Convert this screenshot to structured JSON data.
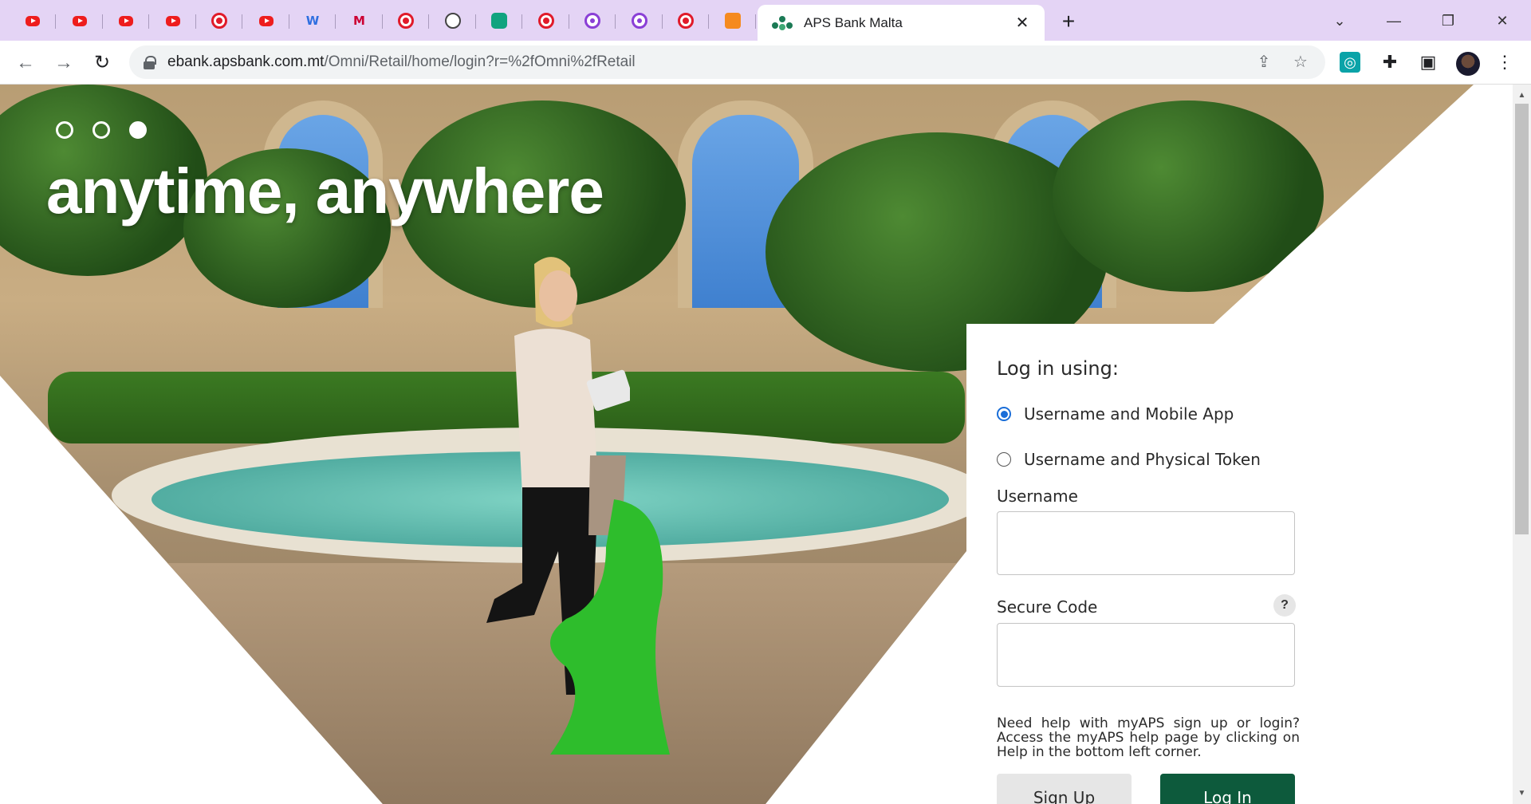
{
  "browser": {
    "mini_tabs": [
      {
        "icon": "youtube-icon",
        "type": "yt"
      },
      {
        "icon": "youtube-icon",
        "type": "yt"
      },
      {
        "icon": "youtube-icon",
        "type": "yt"
      },
      {
        "icon": "youtube-icon",
        "type": "yt"
      },
      {
        "icon": "red-circle-icon",
        "type": "ring"
      },
      {
        "icon": "youtube-icon",
        "type": "yt"
      },
      {
        "icon": "w-logo-icon",
        "type": "w",
        "glyph": "W"
      },
      {
        "icon": "gmail-icon",
        "type": "m",
        "glyph": "M"
      },
      {
        "icon": "red-circle-icon",
        "type": "ring"
      },
      {
        "icon": "openai-icon",
        "type": "gpt"
      },
      {
        "icon": "chatgpt-icon",
        "type": "gptg"
      },
      {
        "icon": "red-circle-icon",
        "type": "ring"
      },
      {
        "icon": "purple-circle-icon",
        "type": "purple"
      },
      {
        "icon": "purple-circle-icon",
        "type": "purple"
      },
      {
        "icon": "red-circle-icon",
        "type": "ring"
      },
      {
        "icon": "fox-icon",
        "type": "fox"
      }
    ],
    "active_tab": {
      "title": "APS Bank Malta",
      "close": "✕"
    },
    "new_tab": "+",
    "window": {
      "dropdown": "⌄",
      "minimize": "—",
      "restore": "❐",
      "close": "✕"
    },
    "nav": {
      "back": "←",
      "forward": "→",
      "reload": "↻"
    },
    "url": {
      "host": "ebank.apsbank.com.mt",
      "path": "/Omni/Retail/home/login?r=%2fOmni%2fRetail"
    },
    "omni_icons": {
      "share": "⇪",
      "bookmark": "☆"
    },
    "extensions": {
      "ext1": "◎",
      "puzzle": "✚",
      "sidepanel": "▣",
      "menu": "⋮"
    }
  },
  "hero": {
    "caption": "anytime, anywhere",
    "dots": [
      {
        "active": false
      },
      {
        "active": false
      },
      {
        "active": true
      }
    ]
  },
  "login": {
    "heading": "Log in using:",
    "options": [
      {
        "label": "Username and Mobile App",
        "checked": true
      },
      {
        "label": "Username and Physical Token",
        "checked": false
      }
    ],
    "username_label": "Username",
    "username_value": "",
    "secure_code_label": "Secure Code",
    "secure_code_value": "",
    "help_badge": "?",
    "help_text": "Need help with myAPS sign up or login? Access the myAPS help page by clicking on Help in the bottom left corner.",
    "signup_label": "Sign Up",
    "login_label": "Log In"
  },
  "colors": {
    "tabstrip": "#e4d4f5",
    "brand_green": "#0d5a3c",
    "radio_blue": "#1a6ed8"
  }
}
